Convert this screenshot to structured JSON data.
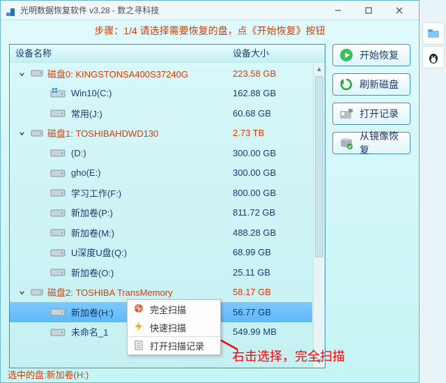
{
  "title": "光明数据恢复软件 v3.28 - 数之寻科技",
  "step_line": "步骤：1/4 请选择需要恢复的盘，点《开始恢复》按钮",
  "columns": {
    "name": "设备名称",
    "size": "设备大小"
  },
  "disks": [
    {
      "label": "磁盘0: KINGSTONSA400S37240G",
      "size": "223.58 GB",
      "vols": [
        {
          "label": "Win10(C:)",
          "size": "162.88 GB",
          "os": true
        },
        {
          "label": "常用(J:)",
          "size": "60.68 GB"
        }
      ]
    },
    {
      "label": "磁盘1: TOSHIBAHDWD130",
      "size": "2.73 TB",
      "vols": [
        {
          "label": "(D:)",
          "size": "300.00 GB"
        },
        {
          "label": "gho(E:)",
          "size": "300.00 GB"
        },
        {
          "label": "学习工作(F:)",
          "size": "800.00 GB"
        },
        {
          "label": "新加卷(P:)",
          "size": "811.72 GB"
        },
        {
          "label": "新加卷(M:)",
          "size": "488.28 GB"
        },
        {
          "label": "U深度U盘(Q:)",
          "size": "68.99 GB"
        },
        {
          "label": "新加卷(O:)",
          "size": "25.11 GB"
        }
      ]
    },
    {
      "label": "磁盘2: TOSHIBA  TransMemory",
      "size": "58.17 GB",
      "vols": [
        {
          "label": "新加卷(H:)",
          "size": "56.77 GB",
          "selected": true
        },
        {
          "label": "未命名_1",
          "size": "549.99 MB"
        }
      ]
    }
  ],
  "buttons": {
    "start": "开始恢复",
    "refresh": "刷新磁盘",
    "openlog": "打开记录",
    "imgrec": "从镜像恢复"
  },
  "ctx": {
    "full": "完全扫描",
    "fast": "快速扫描",
    "openhist": "打开扫描记录"
  },
  "status": "选中的盘:新加卷(H:)",
  "annotation": "右击选择，完全扫描"
}
